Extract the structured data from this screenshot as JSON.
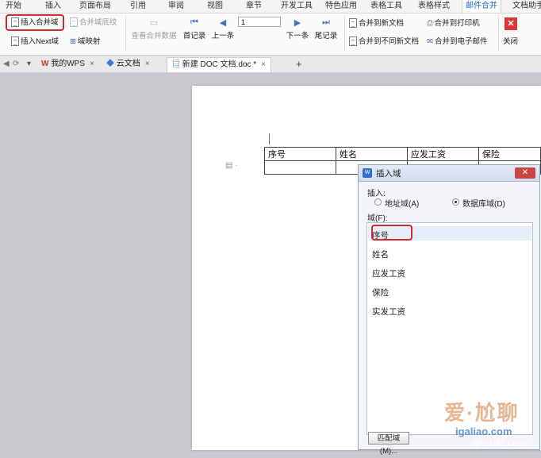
{
  "menu": {
    "tabs": [
      {
        "label": "开始"
      },
      {
        "label": "插入"
      },
      {
        "label": "页面布局"
      },
      {
        "label": "引用"
      },
      {
        "label": "审阅"
      },
      {
        "label": "视图"
      },
      {
        "label": "章节"
      },
      {
        "label": "开发工具"
      },
      {
        "label": "特色应用"
      },
      {
        "label": "表格工具"
      },
      {
        "label": "表格样式"
      },
      {
        "label": "邮件合并"
      },
      {
        "label": "文档助手"
      }
    ],
    "active_tab": "邮件合并"
  },
  "ribbon": {
    "insert_merge_field": "插入合并域",
    "merge_field_shading": "合并域底纹",
    "insert_next_field": "插入Next域",
    "field_map": "域映射",
    "view_merged_data": "查看合并数据",
    "first_record": "首记录",
    "prev_record": "上一条",
    "record_number": "1",
    "next_record": "下一条",
    "last_record": "尾记录",
    "merge_to_new_doc": "合并到新文档",
    "merge_to_different_docs": "合并到不同新文档",
    "merge_to_printer": "合并到打印机",
    "merge_to_email": "合并到电子邮件",
    "close": "关闭"
  },
  "doc_tabs": {
    "items": [
      {
        "label": "我的WPS"
      },
      {
        "label": "云文档"
      },
      {
        "label": "新建 DOC 文档.doc *"
      }
    ],
    "active": "新建 DOC 文档.doc *"
  },
  "document": {
    "table_headers": [
      "序号",
      "姓名",
      "应发工资",
      "保险"
    ]
  },
  "dialog": {
    "title": "插入域",
    "close_label": "✕",
    "insert_label": "插入:",
    "radio_address": "地址域(A)",
    "radio_database": "数据库域(D)",
    "selected_radio": "数据库域(D)",
    "field_label": "域(F):",
    "fields": [
      "序号",
      "姓名",
      "应发工资",
      "保险",
      "实发工资"
    ],
    "selected_field": "序号",
    "match_button": "匹配域(M)..."
  },
  "watermark": {
    "text_cn": "爱·尬聊",
    "text_cn2": "聊",
    "url": "igaliao.com",
    "url2": "qkoufu.com-"
  },
  "colors": {
    "accent_blue": "#1c64c2",
    "highlight_red": "#d32b2b",
    "close_red": "#d7383b"
  }
}
